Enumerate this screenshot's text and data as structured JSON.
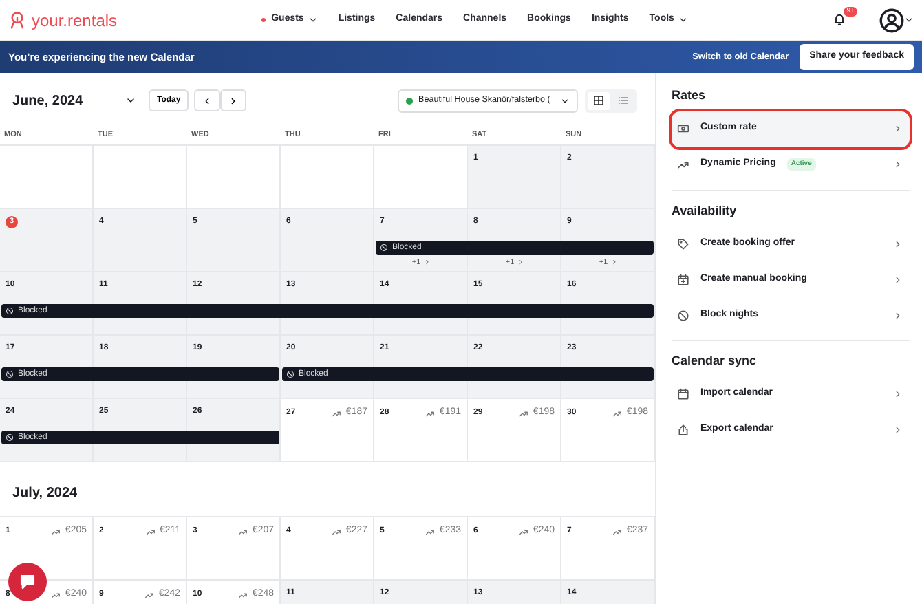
{
  "nav": {
    "logo": "your.rentals",
    "items": [
      {
        "label": "Guests",
        "alert": true,
        "dropdown": true
      },
      {
        "label": "Listings",
        "alert": false,
        "dropdown": false
      },
      {
        "label": "Calendars",
        "alert": false,
        "dropdown": false
      },
      {
        "label": "Channels",
        "alert": false,
        "dropdown": false
      },
      {
        "label": "Bookings",
        "alert": false,
        "dropdown": false
      },
      {
        "label": "Insights",
        "alert": false,
        "dropdown": false
      },
      {
        "label": "Tools",
        "alert": false,
        "dropdown": true
      }
    ],
    "notifications": "9+"
  },
  "banner": {
    "message": "You’re experiencing the new Calendar",
    "link": "Switch to old Calendar",
    "button": "Share your feedback"
  },
  "toolbar": {
    "month": "June, 2024",
    "today": "Today",
    "listing": {
      "label": "Beautiful House Skanör/falsterbo (",
      "color": "#2e9e4f"
    },
    "views": [
      {
        "kind": "grid",
        "selected": true
      },
      {
        "kind": "list",
        "selected": false
      }
    ]
  },
  "calendar": {
    "weekdays": [
      "MON",
      "TUE",
      "WED",
      "THU",
      "FRI",
      "SAT",
      "SUN"
    ],
    "months": [
      {
        "weeks": [
          {
            "days": [
              {
                "available": true
              },
              {
                "available": true
              },
              {
                "available": true
              },
              {
                "available": true
              },
              {
                "available": true
              },
              {
                "date": "1",
                "available": false
              },
              {
                "date": "2",
                "available": false
              }
            ]
          },
          {
            "days": [
              {
                "date": "3",
                "available": false,
                "today": true
              },
              {
                "date": "4",
                "available": false
              },
              {
                "date": "5",
                "available": false
              },
              {
                "date": "6",
                "available": false
              },
              {
                "date": "7",
                "available": false,
                "bar": "Blocked",
                "more": "+1"
              },
              {
                "date": "8",
                "available": false,
                "more": "+1"
              },
              {
                "date": "9",
                "available": false,
                "more": "+1",
                "bar_end": true
              }
            ]
          },
          {
            "days": [
              {
                "date": "10",
                "available": false,
                "bar": "Blocked"
              },
              {
                "date": "11",
                "available": false
              },
              {
                "date": "12",
                "available": false
              },
              {
                "date": "13",
                "available": false
              },
              {
                "date": "14",
                "available": false
              },
              {
                "date": "15",
                "available": false
              },
              {
                "date": "16",
                "available": false,
                "bar_end": true
              }
            ]
          },
          {
            "days": [
              {
                "date": "17",
                "available": false,
                "bar": "Blocked"
              },
              {
                "date": "18",
                "available": false
              },
              {
                "date": "19",
                "available": false,
                "bar_end": true
              },
              {
                "date": "20",
                "available": false,
                "bar": "Blocked"
              },
              {
                "date": "21",
                "available": false
              },
              {
                "date": "22",
                "available": false
              },
              {
                "date": "23",
                "available": false,
                "bar_end": true
              }
            ]
          },
          {
            "days": [
              {
                "date": "24",
                "available": false,
                "bar": "Blocked"
              },
              {
                "date": "25",
                "available": false
              },
              {
                "date": "26",
                "available": false,
                "bar_end": true
              },
              {
                "date": "27",
                "available": true,
                "price": "€187"
              },
              {
                "date": "28",
                "available": true,
                "price": "€191"
              },
              {
                "date": "29",
                "available": true,
                "price": "€198"
              },
              {
                "date": "30",
                "available": true,
                "price": "€198"
              }
            ]
          }
        ]
      },
      {
        "title": "July, 2024",
        "weeks": [
          {
            "days": [
              {
                "date": "1",
                "available": true,
                "price": "€205"
              },
              {
                "date": "2",
                "available": true,
                "price": "€211"
              },
              {
                "date": "3",
                "available": true,
                "price": "€207"
              },
              {
                "date": "4",
                "available": true,
                "price": "€227"
              },
              {
                "date": "5",
                "available": true,
                "price": "€233"
              },
              {
                "date": "6",
                "available": true,
                "price": "€240"
              },
              {
                "date": "7",
                "available": true,
                "price": "€237"
              }
            ]
          },
          {
            "days": [
              {
                "date": "8",
                "available": true,
                "price": "€240"
              },
              {
                "date": "9",
                "available": true,
                "price": "€242"
              },
              {
                "date": "10",
                "available": true,
                "price": "€248"
              },
              {
                "date": "11",
                "available": false
              },
              {
                "date": "12",
                "available": false
              },
              {
                "date": "13",
                "available": false
              },
              {
                "date": "14",
                "available": false
              }
            ]
          }
        ]
      }
    ]
  },
  "sidebar": [
    {
      "title": "Rates",
      "items": [
        {
          "label": "Custom rate",
          "selected": true
        },
        {
          "label": "Dynamic Pricing",
          "badge": "Active",
          "selected": false
        }
      ]
    },
    {
      "title": "Availability",
      "items": [
        {
          "label": "Create booking offer",
          "selected": false
        },
        {
          "label": "Create manual booking",
          "selected": false
        },
        {
          "label": "Block nights",
          "selected": false
        }
      ]
    },
    {
      "title": "Calendar sync",
      "items": [
        {
          "label": "Import calendar",
          "selected": false
        },
        {
          "label": "Export calendar",
          "selected": false
        }
      ]
    }
  ]
}
